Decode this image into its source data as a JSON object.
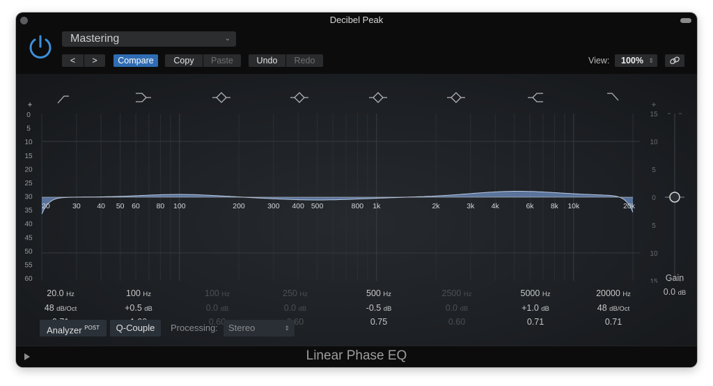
{
  "window": {
    "title": "Decibel Peak"
  },
  "header": {
    "preset": "Mastering",
    "nav_prev": "<",
    "nav_next": ">",
    "compare": "Compare",
    "copy": "Copy",
    "paste": "Paste",
    "undo": "Undo",
    "redo": "Redo",
    "view_label": "View:",
    "view_value": "100%"
  },
  "graph": {
    "left_scale_label_top": "+",
    "left_scale_label_bottom": "-",
    "left_scale": [
      "0",
      "5",
      "10",
      "15",
      "20",
      "25",
      "30",
      "35",
      "40",
      "45",
      "50",
      "55",
      "60"
    ],
    "right_scale_label_top": "+",
    "right_scale_label_bottom": "-",
    "right_scale": [
      "15",
      "10",
      "5",
      "0",
      "5",
      "10",
      "15"
    ],
    "right_scale_values_db": [
      15,
      10,
      5,
      0,
      -5,
      -10,
      -15
    ],
    "freq_labels": [
      {
        "label": "20",
        "hz": 20
      },
      {
        "label": "30",
        "hz": 30
      },
      {
        "label": "40",
        "hz": 40
      },
      {
        "label": "50",
        "hz": 50
      },
      {
        "label": "60",
        "hz": 60
      },
      {
        "label": "80",
        "hz": 80
      },
      {
        "label": "100",
        "hz": 100
      },
      {
        "label": "200",
        "hz": 200
      },
      {
        "label": "300",
        "hz": 300
      },
      {
        "label": "400",
        "hz": 400
      },
      {
        "label": "500",
        "hz": 500
      },
      {
        "label": "800",
        "hz": 800
      },
      {
        "label": "1k",
        "hz": 1000
      },
      {
        "label": "2k",
        "hz": 2000
      },
      {
        "label": "3k",
        "hz": 3000
      },
      {
        "label": "4k",
        "hz": 4000
      },
      {
        "label": "6k",
        "hz": 6000
      },
      {
        "label": "8k",
        "hz": 8000
      },
      {
        "label": "10k",
        "hz": 10000
      },
      {
        "label": "20k",
        "hz": 20000
      }
    ],
    "freq_range_hz": [
      20,
      20000
    ],
    "gain_range_db": [
      -15,
      15
    ],
    "curve_color": "#6d8fc2",
    "band_icons": [
      "low-cut-icon",
      "low-shelf-icon",
      "bell-icon",
      "bell-icon",
      "bell-icon",
      "bell-icon",
      "high-shelf-icon",
      "high-cut-icon"
    ],
    "gain_knob_db": 0
  },
  "bands": [
    {
      "freq": "20.0",
      "freq_unit": "Hz",
      "gain": "48",
      "gain_unit": "dB/Oct",
      "q": "0.71",
      "enabled": true
    },
    {
      "freq": "100",
      "freq_unit": "Hz",
      "gain": "+0.5",
      "gain_unit": "dB",
      "q": "1.00",
      "enabled": true
    },
    {
      "freq": "100",
      "freq_unit": "Hz",
      "gain": "0.0",
      "gain_unit": "dB",
      "q": "0.60",
      "enabled": false
    },
    {
      "freq": "250",
      "freq_unit": "Hz",
      "gain": "0.0",
      "gain_unit": "dB",
      "q": "0.60",
      "enabled": false
    },
    {
      "freq": "500",
      "freq_unit": "Hz",
      "gain": "-0.5",
      "gain_unit": "dB",
      "q": "0.75",
      "enabled": true
    },
    {
      "freq": "2500",
      "freq_unit": "Hz",
      "gain": "0.0",
      "gain_unit": "dB",
      "q": "0.60",
      "enabled": false
    },
    {
      "freq": "5000",
      "freq_unit": "Hz",
      "gain": "+1.0",
      "gain_unit": "dB",
      "q": "0.71",
      "enabled": true
    },
    {
      "freq": "20000",
      "freq_unit": "Hz",
      "gain": "48",
      "gain_unit": "dB/Oct",
      "q": "0.71",
      "enabled": true
    }
  ],
  "gain": {
    "label": "Gain",
    "value": "0.0",
    "unit": "dB"
  },
  "bottom": {
    "analyzer": "Analyzer",
    "analyzer_sup": "POST",
    "q_couple": "Q-Couple",
    "processing_label": "Processing:",
    "processing_value": "Stereo"
  },
  "footer": {
    "plugin_name": "Linear Phase EQ"
  },
  "colors": {
    "accent": "#2f6cb3",
    "power": "#3f8fd6",
    "curve": "#6d8fc2"
  }
}
